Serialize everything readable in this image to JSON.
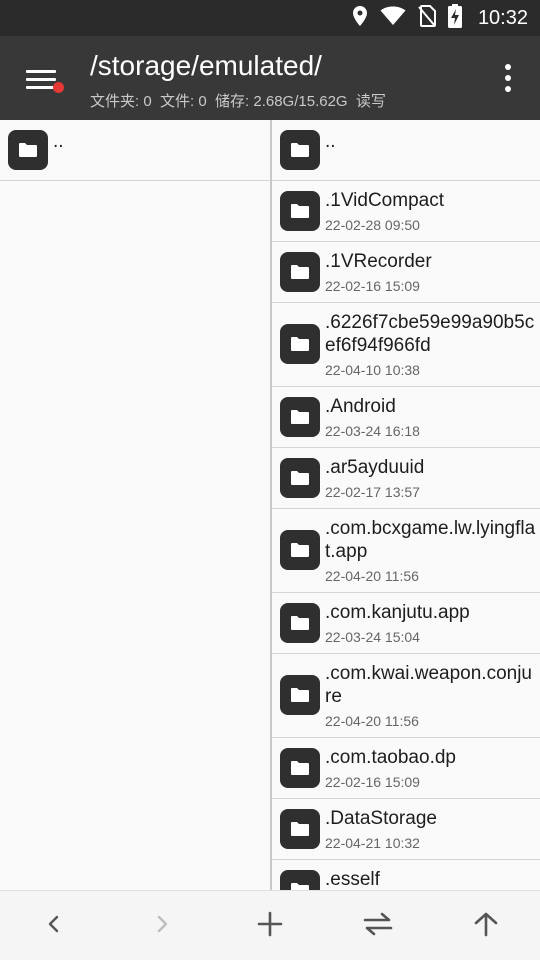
{
  "status_bar": {
    "time": "10:32",
    "icons": [
      "location-icon",
      "wifi-icon",
      "no-sim-icon",
      "battery-charging-icon"
    ]
  },
  "app_bar": {
    "path": "/storage/emulated/",
    "summary": "文件夹: 0  文件: 0  储存: 2.68G/15.62G  读写",
    "menu_icon": "hamburger-menu-icon",
    "notification_color": "#e53935",
    "overflow_icon": "more-vertical-icon"
  },
  "left_pane": {
    "items": [
      {
        "name": "..",
        "date": ""
      }
    ]
  },
  "right_pane": {
    "items": [
      {
        "name": "..",
        "date": ""
      },
      {
        "name": ".1VidCompact",
        "date": "22-02-28 09:50"
      },
      {
        "name": ".1VRecorder",
        "date": "22-02-16 15:09"
      },
      {
        "name": ".6226f7cbe59e99a90b5cef6f94f966fd",
        "date": "22-04-10 10:38"
      },
      {
        "name": ".Android",
        "date": "22-03-24 16:18"
      },
      {
        "name": ".ar5ayduuid",
        "date": "22-02-17 13:57"
      },
      {
        "name": ".com.bcxgame.lw.lyingflat.app",
        "date": "22-04-20 11:56"
      },
      {
        "name": ".com.kanjutu.app",
        "date": "22-03-24 15:04"
      },
      {
        "name": ".com.kwai.weapon.conjure",
        "date": "22-04-20 11:56"
      },
      {
        "name": ".com.taobao.dp",
        "date": "22-02-16 15:09"
      },
      {
        "name": ".DataStorage",
        "date": "22-04-21 10:32"
      },
      {
        "name": ".esself",
        "date": ""
      }
    ]
  },
  "bottom_bar": {
    "buttons": [
      "back-icon",
      "forward-icon",
      "add-icon",
      "swap-icon",
      "up-icon"
    ]
  },
  "colors": {
    "status_bar": "#2b2b2b",
    "app_bar": "#383838",
    "folder_icon_bg": "#2f2f2f",
    "background": "#fafafa"
  }
}
